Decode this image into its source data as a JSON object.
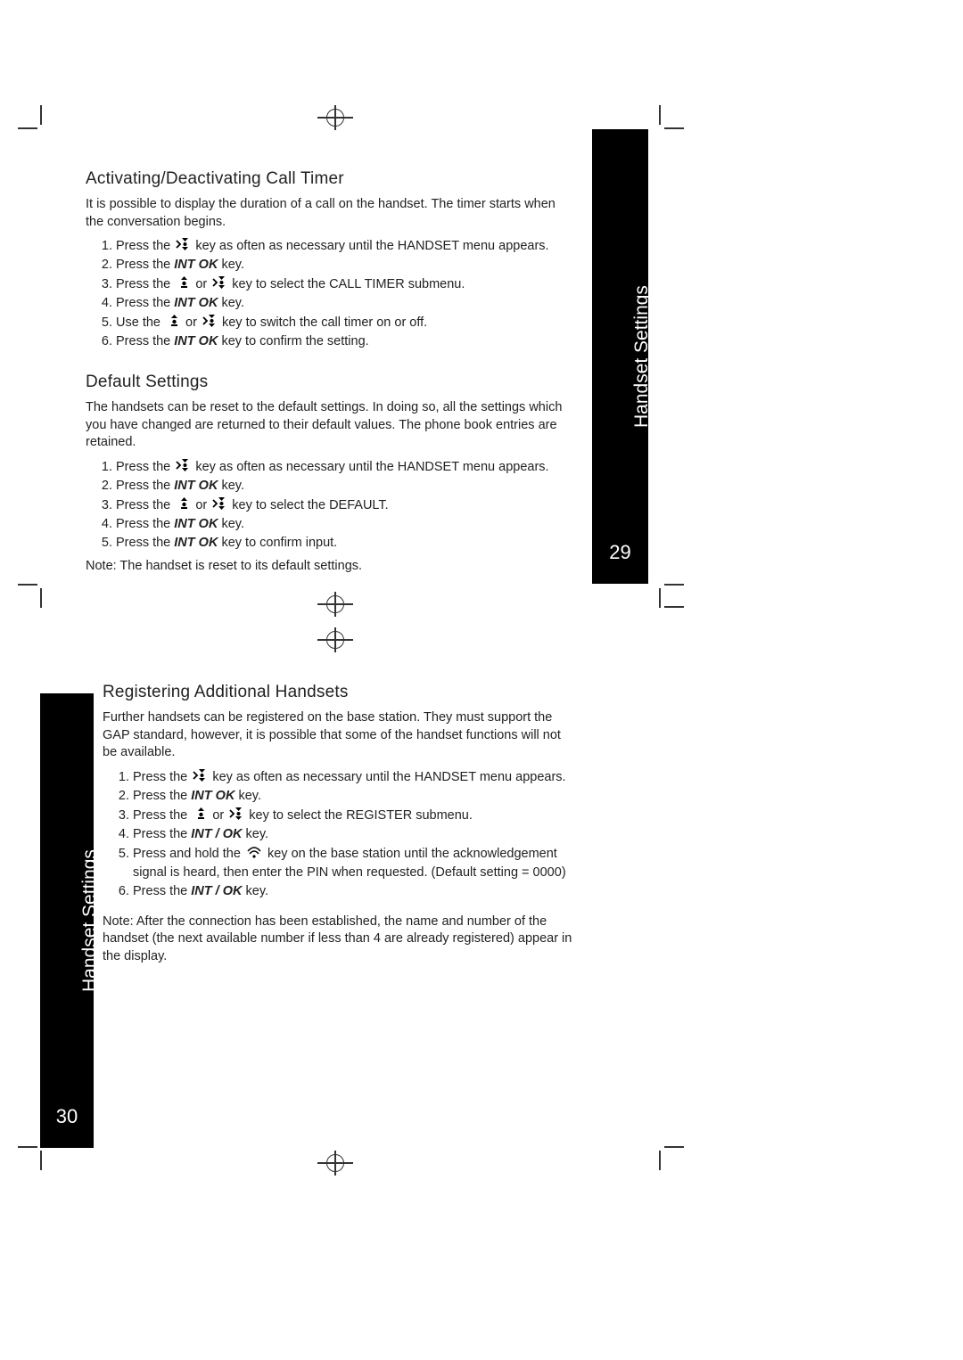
{
  "tab": {
    "label": "Handset Settings",
    "page_top": "29",
    "page_bottom": "30"
  },
  "s1": {
    "title": "Activating/Deactivating Call Timer",
    "intro": "It is possible to display the duration of a call on the handset. The timer starts when the conversation begins.",
    "steps": {
      "a1": "Press the ",
      "a2": " key as often as necessary until the HANDSET menu appears.",
      "b1": "Press the ",
      "b2": " key.",
      "c1": "Press the ",
      "c2": " or ",
      "c3": " key to select the CALL TIMER submenu.",
      "d1": "Press the ",
      "d2": " key.",
      "e1": "Use the ",
      "e2": " or ",
      "e3": " key to switch the call timer on or off.",
      "f1": "Press the ",
      "f2": " key to confirm the setting."
    }
  },
  "s2": {
    "title": "Default Settings",
    "intro": "The handsets can be reset to the default settings. In doing so, all the settings which you have changed are returned to their default values. The phone book entries are retained.",
    "steps": {
      "a1": "Press the ",
      "a2": " key as often as necessary until the HANDSET menu appears.",
      "b1": "Press the ",
      "b2": " key.",
      "c1": "Press the ",
      "c2": " or ",
      "c3": " key to select the DEFAULT.",
      "d1": "Press the ",
      "d2": " key.",
      "e1": "Press the ",
      "e2": " key to confirm input."
    },
    "note": "Note: The handset is reset to its default settings."
  },
  "s3": {
    "title": "Registering Additional Handsets",
    "intro": "Further handsets can be registered on the base station. They must support the GAP standard, however, it is possible that some of the handset functions will not be available.",
    "steps": {
      "a1": "Press the ",
      "a2": " key as often as necessary until the HANDSET menu appears.",
      "b1": "Press the ",
      "b2": " key.",
      "c1": "Press the ",
      "c2": " or ",
      "c3": " key to select the REGISTER submenu.",
      "d1": "Press the ",
      "d2": " key.",
      "e1": "Press and hold the ",
      "e2": " key on the base station until the acknowledgement signal is heard, then enter the PIN when requested. (Default setting = 0000)",
      "f1": "Press the ",
      "f2": " key."
    },
    "note": "Note: After the connection has been established, the name and number of the handset (the next available number if less than 4 are already registered) appear in the display."
  },
  "keys": {
    "int_ok": "INT  OK",
    "int_slash_ok": "INT / OK"
  }
}
